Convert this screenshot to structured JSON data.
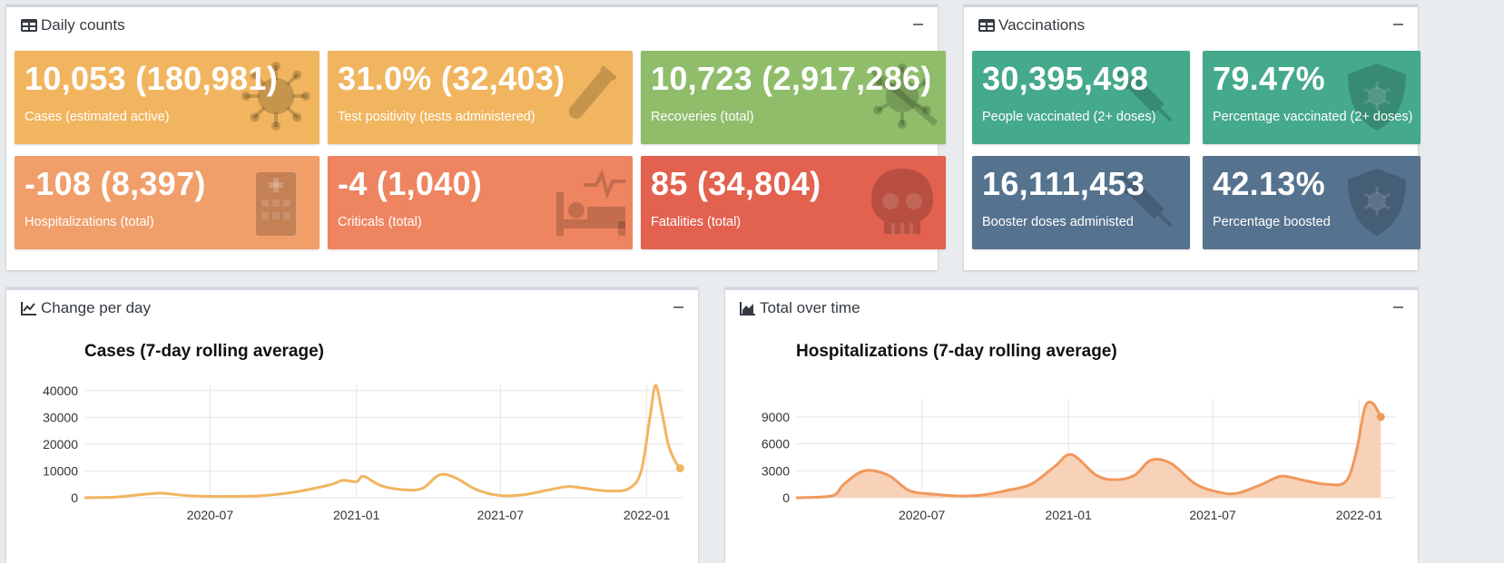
{
  "daily": {
    "title": "Daily counts",
    "tiles": [
      {
        "value": "10,053 (180,981)",
        "label": "Cases (estimated active)",
        "icon": "virus-icon",
        "color": "#f1b55f"
      },
      {
        "value": "31.0% (32,403)",
        "label": "Test positivity (tests administered)",
        "icon": "vial-icon",
        "color": "#f1b55f"
      },
      {
        "value": "10,723 (2,917,286)",
        "label": "Recoveries (total)",
        "icon": "virus-slash-icon",
        "color": "#8fbd6a"
      },
      {
        "value": "-108 (8,397)",
        "label": "Hospitalizations (total)",
        "icon": "hospital-icon",
        "color": "#f09e6a"
      },
      {
        "value": "-4 (1,040)",
        "label": "Criticals (total)",
        "icon": "procedures-icon",
        "color": "#ee8560"
      },
      {
        "value": "85 (34,804)",
        "label": "Fatalities (total)",
        "icon": "skull-icon",
        "color": "#e2614f"
      }
    ]
  },
  "vaccinations": {
    "title": "Vaccinations",
    "tiles": [
      {
        "value": "30,395,498",
        "label": "People vaccinated (2+ doses)",
        "icon": "syringe-icon",
        "color": "#45a98b"
      },
      {
        "value": "79.47%",
        "label": "Percentage vaccinated (2+ doses)",
        "icon": "shield-virus-icon",
        "color": "#45a98b"
      },
      {
        "value": "16,111,453",
        "label": "Booster doses administed",
        "icon": "syringe-icon",
        "color": "#55728f"
      },
      {
        "value": "42.13%",
        "label": "Percentage boosted",
        "icon": "shield-virus-icon",
        "color": "#55728f"
      }
    ]
  },
  "change": {
    "title": "Change per day"
  },
  "total": {
    "title": "Total over time"
  },
  "chart_data": [
    {
      "type": "line",
      "title": "Cases (7-day rolling average)",
      "color": "#f1b55f",
      "x_ticks": [
        "2020-07",
        "2021-01",
        "2021-07",
        "2022-01"
      ],
      "y_ticks": [
        0,
        10000,
        20000,
        30000,
        40000
      ],
      "xlim": [
        "2020-01-25",
        "2022-02-15"
      ],
      "ylim": [
        0,
        42000
      ],
      "grid": true,
      "points": [
        [
          "2020-01-25",
          0
        ],
        [
          "2020-03-01",
          200
        ],
        [
          "2020-03-25",
          800
        ],
        [
          "2020-04-10",
          1300
        ],
        [
          "2020-05-01",
          1700
        ],
        [
          "2020-06-01",
          800
        ],
        [
          "2020-07-01",
          500
        ],
        [
          "2020-08-01",
          500
        ],
        [
          "2020-09-01",
          700
        ],
        [
          "2020-10-01",
          1500
        ],
        [
          "2020-11-01",
          3000
        ],
        [
          "2020-12-01",
          5000
        ],
        [
          "2020-12-15",
          6500
        ],
        [
          "2021-01-01",
          6000
        ],
        [
          "2021-01-10",
          8000
        ],
        [
          "2021-02-01",
          4500
        ],
        [
          "2021-03-01",
          3000
        ],
        [
          "2021-03-25",
          3500
        ],
        [
          "2021-04-15",
          8500
        ],
        [
          "2021-05-05",
          7500
        ],
        [
          "2021-06-01",
          3000
        ],
        [
          "2021-07-01",
          800
        ],
        [
          "2021-08-01",
          1200
        ],
        [
          "2021-09-01",
          3000
        ],
        [
          "2021-09-25",
          4200
        ],
        [
          "2021-10-15",
          3500
        ],
        [
          "2021-11-15",
          2500
        ],
        [
          "2021-12-10",
          3500
        ],
        [
          "2021-12-25",
          10000
        ],
        [
          "2022-01-05",
          30000
        ],
        [
          "2022-01-12",
          42000
        ],
        [
          "2022-01-20",
          32000
        ],
        [
          "2022-01-28",
          20000
        ],
        [
          "2022-02-05",
          14000
        ],
        [
          "2022-02-12",
          11000
        ]
      ]
    },
    {
      "type": "area",
      "title": "Hospitalizations (7-day rolling average)",
      "color": "#f0985c",
      "fill": "#f8d2b8",
      "x_ticks": [
        "2020-07",
        "2021-01",
        "2021-07",
        "2022-01"
      ],
      "y_ticks": [
        0,
        3000,
        6000,
        9000
      ],
      "xlim": [
        "2020-01-25",
        "2022-02-15"
      ],
      "ylim": [
        0,
        11000
      ],
      "grid": true,
      "points": [
        [
          "2020-01-25",
          0
        ],
        [
          "2020-03-10",
          200
        ],
        [
          "2020-03-25",
          1500
        ],
        [
          "2020-04-20",
          3000
        ],
        [
          "2020-05-20",
          2500
        ],
        [
          "2020-06-15",
          800
        ],
        [
          "2020-07-15",
          400
        ],
        [
          "2020-08-15",
          200
        ],
        [
          "2020-09-15",
          300
        ],
        [
          "2020-10-15",
          800
        ],
        [
          "2020-11-15",
          1500
        ],
        [
          "2020-12-15",
          3500
        ],
        [
          "2021-01-05",
          4800
        ],
        [
          "2021-02-05",
          2500
        ],
        [
          "2021-03-01",
          2000
        ],
        [
          "2021-03-25",
          2500
        ],
        [
          "2021-04-15",
          4200
        ],
        [
          "2021-05-10",
          3800
        ],
        [
          "2021-06-10",
          1500
        ],
        [
          "2021-07-10",
          600
        ],
        [
          "2021-08-01",
          500
        ],
        [
          "2021-09-01",
          1500
        ],
        [
          "2021-09-25",
          2400
        ],
        [
          "2021-10-20",
          2000
        ],
        [
          "2021-11-20",
          1500
        ],
        [
          "2021-12-15",
          1800
        ],
        [
          "2021-12-28",
          5000
        ],
        [
          "2022-01-08",
          10000
        ],
        [
          "2022-01-18",
          10500
        ],
        [
          "2022-01-28",
          9000
        ]
      ]
    }
  ]
}
